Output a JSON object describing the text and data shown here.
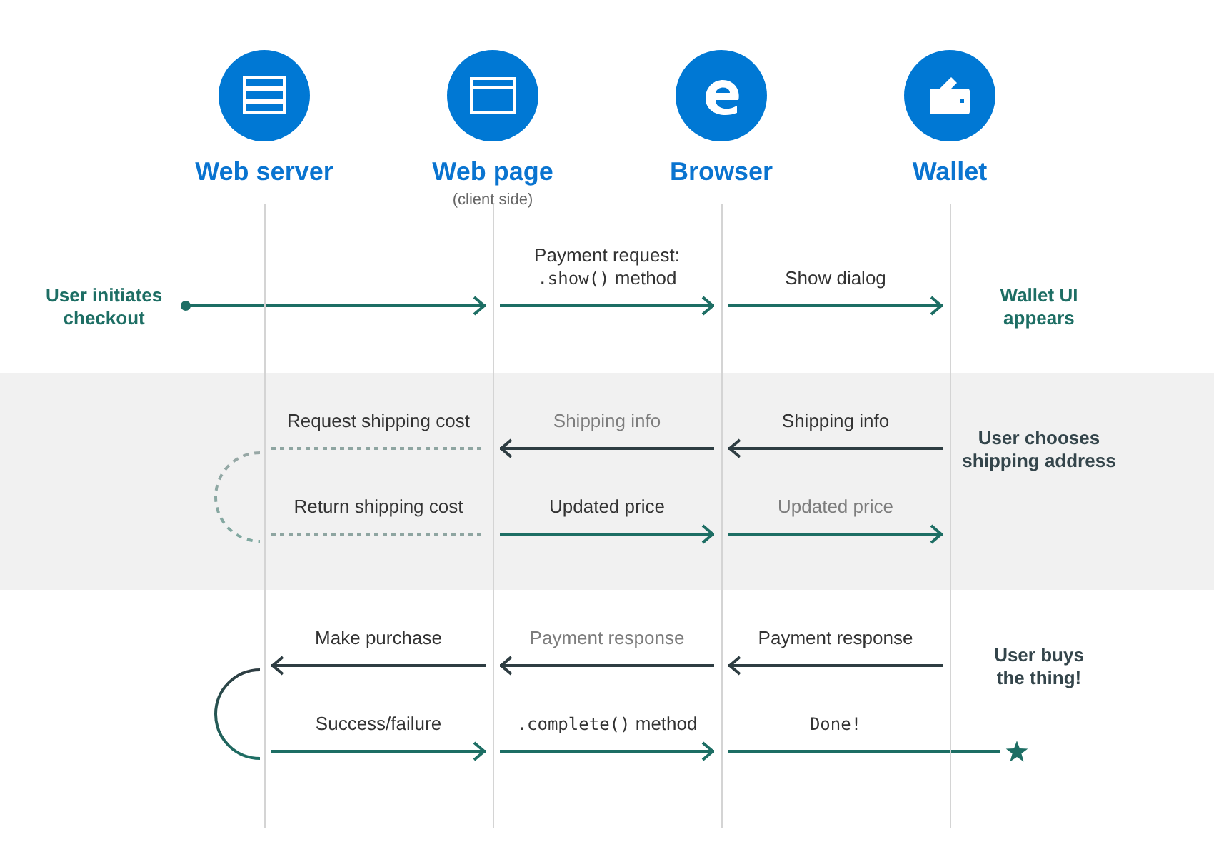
{
  "lanes": [
    {
      "kind": "server",
      "name": "Web server"
    },
    {
      "kind": "page",
      "name": "Web page",
      "subtitle": "(client side)"
    },
    {
      "kind": "browser",
      "name": "Browser"
    },
    {
      "kind": "wallet",
      "name": "Wallet"
    }
  ],
  "sections": [
    {
      "shaded": false,
      "left_note": {
        "lines": [
          "User initiates",
          "checkout"
        ],
        "color": "#1d6e64"
      },
      "right_note": {
        "lines": [
          "Wallet UI",
          "appears"
        ],
        "color": "#1d6e64"
      },
      "rows": [
        {
          "messages": [
            {
              "kind": "entry",
              "leftward": false,
              "dashed": false
            },
            {
              "kind": "call",
              "leftward": false,
              "dashed": false,
              "muted": false,
              "lines": [
                [
                  {
                    "text": "Payment request:",
                    "code": false
                  }
                ],
                [
                  {
                    "text": ".show()",
                    "code": true
                  },
                  {
                    "text": " method",
                    "code": false
                  }
                ]
              ]
            },
            {
              "kind": "call",
              "leftward": false,
              "dashed": false,
              "muted": false,
              "lines": [
                [
                  {
                    "text": "Show dialog",
                    "code": false
                  }
                ]
              ]
            }
          ]
        }
      ]
    },
    {
      "shaded": true,
      "loop": {
        "dashed": true
      },
      "right_note": {
        "lines": [
          "User chooses",
          "shipping address"
        ],
        "color": "#34454b"
      },
      "rows": [
        {
          "messages": [
            {
              "kind": "call",
              "leftward": true,
              "dashed": true,
              "muted": false,
              "lines": [
                [
                  {
                    "text": "Request shipping cost",
                    "code": false
                  }
                ]
              ]
            },
            {
              "kind": "call",
              "leftward": true,
              "dashed": false,
              "muted": true,
              "lines": [
                [
                  {
                    "text": "Shipping info",
                    "code": false
                  }
                ]
              ]
            },
            {
              "kind": "call",
              "leftward": true,
              "dashed": false,
              "muted": false,
              "lines": [
                [
                  {
                    "text": "Shipping info",
                    "code": false
                  }
                ]
              ]
            }
          ]
        },
        {
          "messages": [
            {
              "kind": "call",
              "leftward": false,
              "dashed": true,
              "muted": false,
              "lines": [
                [
                  {
                    "text": "Return shipping cost",
                    "code": false
                  }
                ]
              ]
            },
            {
              "kind": "call",
              "leftward": false,
              "dashed": false,
              "muted": false,
              "lines": [
                [
                  {
                    "text": "Updated price",
                    "code": false
                  }
                ]
              ]
            },
            {
              "kind": "call",
              "leftward": false,
              "dashed": false,
              "muted": true,
              "lines": [
                [
                  {
                    "text": "Updated price",
                    "code": false
                  }
                ]
              ]
            }
          ]
        }
      ]
    },
    {
      "shaded": false,
      "loop": {
        "dashed": false
      },
      "right_note": {
        "lines": [
          "User buys",
          "the thing!"
        ],
        "color": "#34454b"
      },
      "rows": [
        {
          "messages": [
            {
              "kind": "call",
              "leftward": true,
              "dashed": false,
              "muted": false,
              "lines": [
                [
                  {
                    "text": "Make purchase",
                    "code": false
                  }
                ]
              ]
            },
            {
              "kind": "call",
              "leftward": true,
              "dashed": false,
              "muted": true,
              "lines": [
                [
                  {
                    "text": "Payment response",
                    "code": false
                  }
                ]
              ]
            },
            {
              "kind": "call",
              "leftward": true,
              "dashed": false,
              "muted": false,
              "lines": [
                [
                  {
                    "text": "Payment response",
                    "code": false
                  }
                ]
              ]
            }
          ]
        },
        {
          "messages": [
            {
              "kind": "call",
              "leftward": false,
              "dashed": false,
              "muted": false,
              "lines": [
                [
                  {
                    "text": "Success/failure",
                    "code": false
                  }
                ]
              ]
            },
            {
              "kind": "call",
              "leftward": false,
              "dashed": false,
              "muted": false,
              "lines": [
                [
                  {
                    "text": ".complete()",
                    "code": true
                  },
                  {
                    "text": " method",
                    "code": false
                  }
                ]
              ]
            },
            {
              "kind": "exit",
              "leftward": false,
              "dashed": false,
              "muted": false,
              "lines": [
                [
                  {
                    "text": "Done!",
                    "code": true
                  }
                ]
              ]
            }
          ]
        }
      ]
    }
  ]
}
